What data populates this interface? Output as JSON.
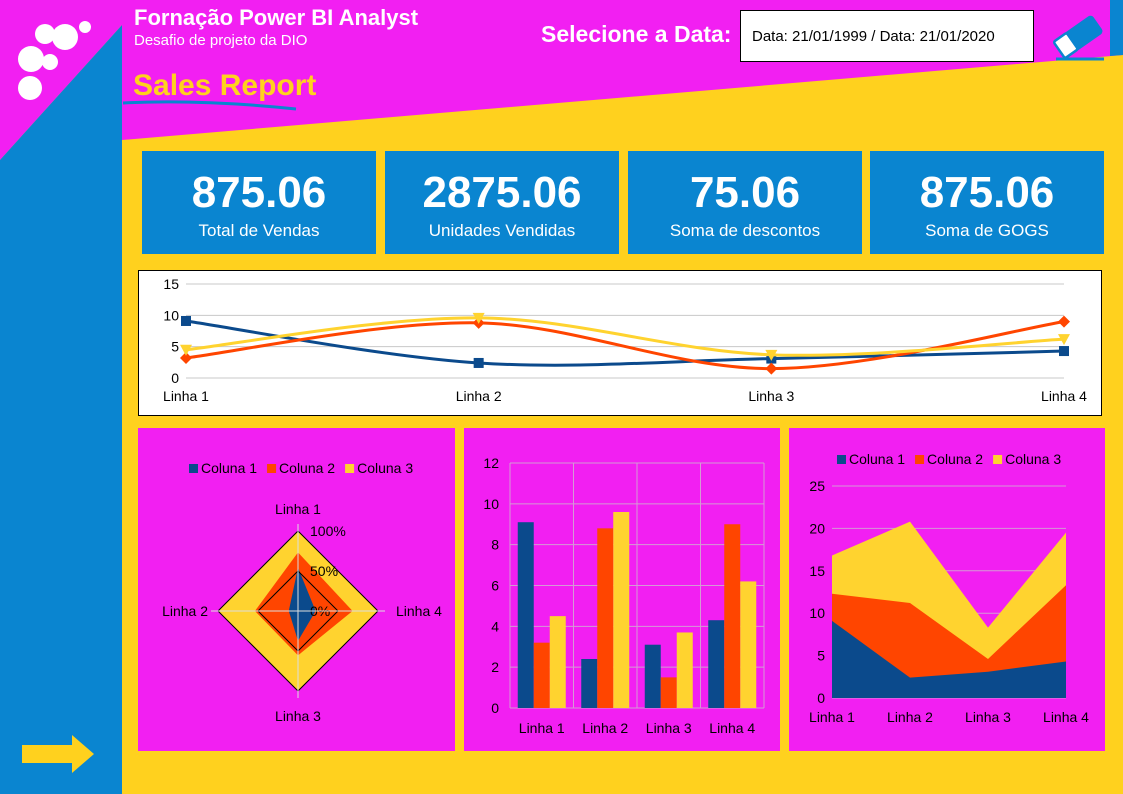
{
  "header": {
    "title": "Fornação Power BI Analyst",
    "subtitle": "Desafio de projeto da DIO",
    "report_title": "Sales Report",
    "date_label": "Selecione a Data:",
    "date_range": "Data: 21/01/1999 / Data: 21/01/2020",
    "eraser_icon": "eraser-icon",
    "logo_icon": "dots-logo-icon",
    "next_icon": "arrow-right-icon"
  },
  "kpis": [
    {
      "value": "875.06",
      "label": "Total de Vendas"
    },
    {
      "value": "2875.06",
      "label": "Unidades Vendidas"
    },
    {
      "value": "75.06",
      "label": "Soma de descontos"
    },
    {
      "value": "875.06",
      "label": "Soma de GOGS"
    }
  ],
  "colors": {
    "background": "#FFD11E",
    "magenta": "#F21FF2",
    "blue": "#0A85D0",
    "series1": "#0B4A8C",
    "series2": "#FF4500",
    "series3": "#FFD32F"
  },
  "chart_data": [
    {
      "type": "line",
      "categories": [
        "Linha 1",
        "Linha 2",
        "Linha 3",
        "Linha 4"
      ],
      "series": [
        {
          "name": "Coluna 1",
          "values": [
            9.1,
            2.4,
            3.1,
            4.3
          ]
        },
        {
          "name": "Coluna 2",
          "values": [
            3.2,
            8.8,
            1.5,
            9.0
          ]
        },
        {
          "name": "Coluna 3",
          "values": [
            4.5,
            9.6,
            3.7,
            6.2
          ]
        }
      ],
      "ylim": [
        0,
        15
      ],
      "yticks": [
        "0",
        "5",
        "10",
        "15"
      ],
      "grid": true,
      "smooth": true
    },
    {
      "type": "radar",
      "categories": [
        "Linha 1",
        "Linha 4",
        "Linha 3",
        "Linha 2"
      ],
      "series": [
        {
          "name": "Coluna 1",
          "values": [
            9.1,
            4.3,
            3.1,
            2.4
          ]
        },
        {
          "name": "Coluna 2",
          "values": [
            3.2,
            9.0,
            1.5,
            8.8
          ]
        },
        {
          "name": "Coluna 3",
          "values": [
            4.5,
            6.2,
            3.7,
            9.6
          ]
        }
      ],
      "stacked_percent": true,
      "rings": [
        "0%",
        "50%",
        "100%"
      ],
      "legend": "top"
    },
    {
      "type": "bar",
      "categories": [
        "Linha 1",
        "Linha 2",
        "Linha 3",
        "Linha 4"
      ],
      "series": [
        {
          "name": "Coluna 1",
          "values": [
            9.1,
            2.4,
            3.1,
            4.3
          ]
        },
        {
          "name": "Coluna 2",
          "values": [
            3.2,
            8.8,
            1.5,
            9.0
          ]
        },
        {
          "name": "Coluna 3",
          "values": [
            4.5,
            9.6,
            3.7,
            6.2
          ]
        }
      ],
      "ylim": [
        0,
        12
      ],
      "yticks": [
        "0",
        "2",
        "4",
        "6",
        "8",
        "10",
        "12"
      ],
      "grid": true
    },
    {
      "type": "area",
      "stacked": true,
      "categories": [
        "Linha 1",
        "Linha 2",
        "Linha 3",
        "Linha 4"
      ],
      "series": [
        {
          "name": "Coluna 1",
          "values": [
            9.1,
            2.4,
            3.1,
            4.3
          ]
        },
        {
          "name": "Coluna 2",
          "values": [
            3.2,
            8.8,
            1.5,
            9.0
          ]
        },
        {
          "name": "Coluna 3",
          "values": [
            4.5,
            9.6,
            3.7,
            6.2
          ]
        }
      ],
      "ylim": [
        0,
        25
      ],
      "yticks": [
        "0",
        "5",
        "10",
        "15",
        "20",
        "25"
      ],
      "grid": true,
      "legend": "top"
    }
  ]
}
